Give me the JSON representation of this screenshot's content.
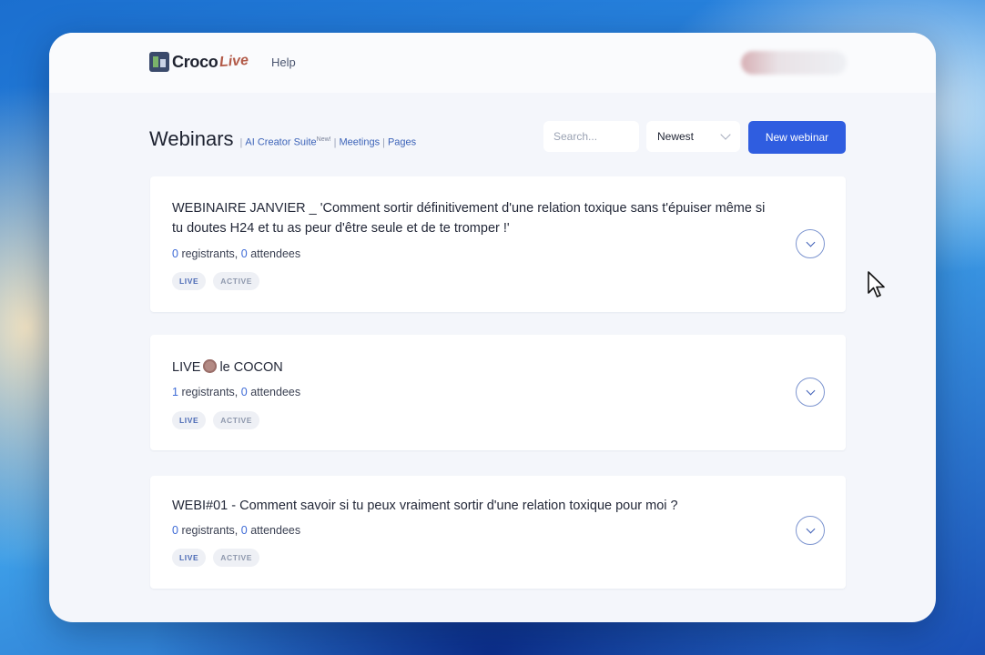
{
  "app": {
    "logo_text": "Croco",
    "logo_accent": "Live",
    "nav_help": "Help"
  },
  "header": {
    "title": "Webinars",
    "subnav": {
      "ai_suite": "AI Creator Suite",
      "ai_badge": "New!",
      "meetings": "Meetings",
      "pages": "Pages",
      "separator": "|"
    },
    "search_placeholder": "Search...",
    "sort_value": "Newest",
    "new_button": "New webinar"
  },
  "webinars": [
    {
      "title": "WEBINAIRE JANVIER _ 'Comment sortir définitivement d'une relation toxique sans t'épuiser même si tu doutes H24 et tu as peur d'être seule et de te tromper !'",
      "registrants": "0",
      "registrants_label": "registrants,",
      "attendees": "0",
      "attendees_label": "attendees",
      "tags": [
        "LIVE",
        "ACTIVE"
      ]
    },
    {
      "title_prefix": "LIVE",
      "title_suffix": "le COCON",
      "registrants": "1",
      "registrants_label": "registrants,",
      "attendees": "0",
      "attendees_label": "attendees",
      "tags": [
        "LIVE",
        "ACTIVE"
      ]
    },
    {
      "title": "WEBI#01 - Comment savoir si tu peux vraiment sortir d'une relation toxique pour moi ?",
      "registrants": "0",
      "registrants_label": "registrants,",
      "attendees": "0",
      "attendees_label": "attendees",
      "tags": [
        "LIVE",
        "ACTIVE"
      ]
    }
  ],
  "colors": {
    "primary": "#2f5de0",
    "link": "#3d6ad6",
    "page_bg": "#f4f6fb"
  }
}
